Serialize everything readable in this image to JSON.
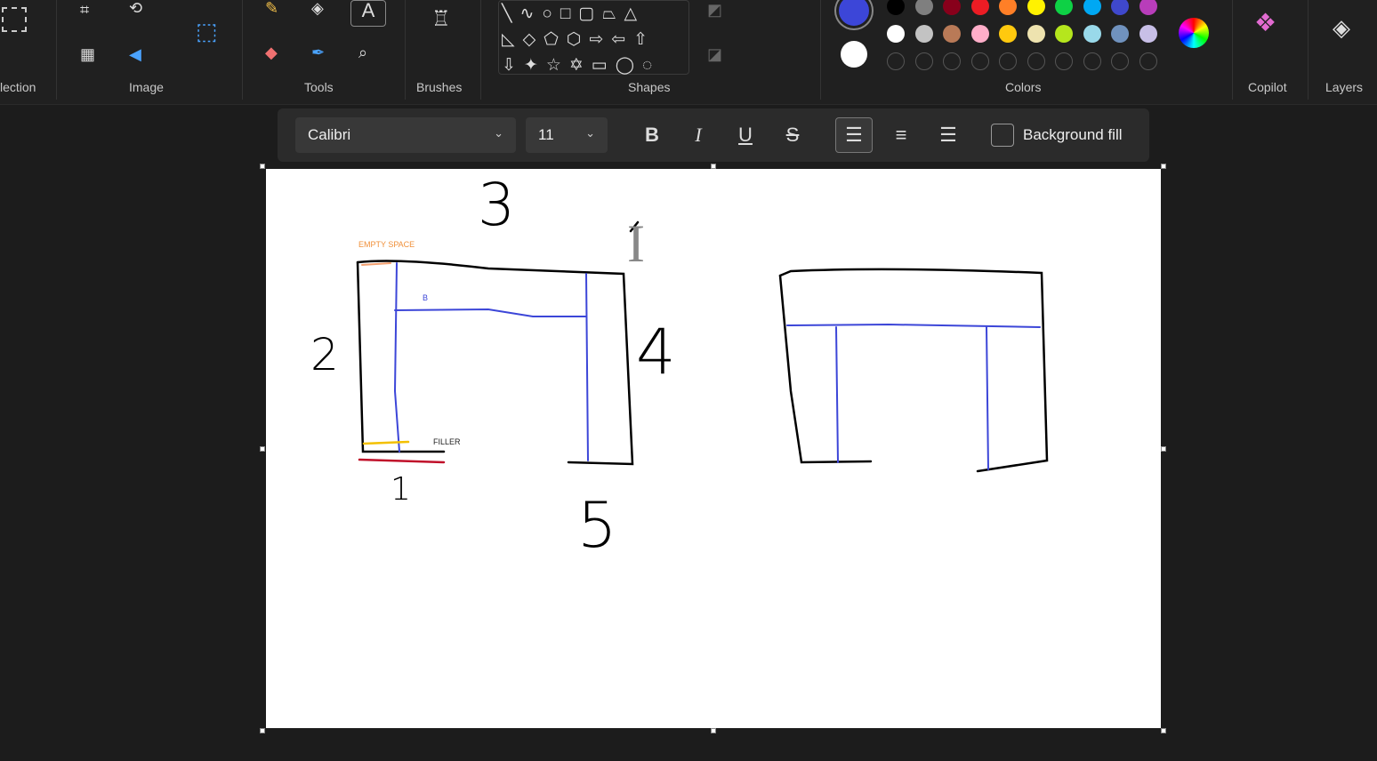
{
  "ribbon": {
    "groups": [
      "lection",
      "Image",
      "Tools",
      "Brushes",
      "Shapes",
      "Colors",
      "Copilot",
      "Layers"
    ]
  },
  "colors": {
    "primary": "#3c46d8",
    "secondary": "#ffffff",
    "row1": [
      "#000000",
      "#7f7f7f",
      "#88001b",
      "#ec1c24",
      "#ff7f27",
      "#fff200",
      "#0ed145",
      "#00a8f3",
      "#3f48cc",
      "#b83dba"
    ],
    "row2": [
      "#ffffff",
      "#c3c3c3",
      "#b97a57",
      "#ffaec9",
      "#ffc90e",
      "#eee3af",
      "#b5e61d",
      "#99d9ea",
      "#7092be",
      "#c8bfe7"
    ]
  },
  "textbar": {
    "font": "Calibri",
    "size": "11",
    "bold": "B",
    "italic": "I",
    "underline": "U",
    "strike": "S",
    "background_fill": "Background fill"
  },
  "canvas": {
    "labels": {
      "empty_space": "EMPTY SPACE",
      "b": "B",
      "filler": "FILLER"
    },
    "numbers": {
      "n1": "1",
      "n2": "2",
      "n3": "3",
      "n4": "4",
      "n5": "5"
    }
  }
}
